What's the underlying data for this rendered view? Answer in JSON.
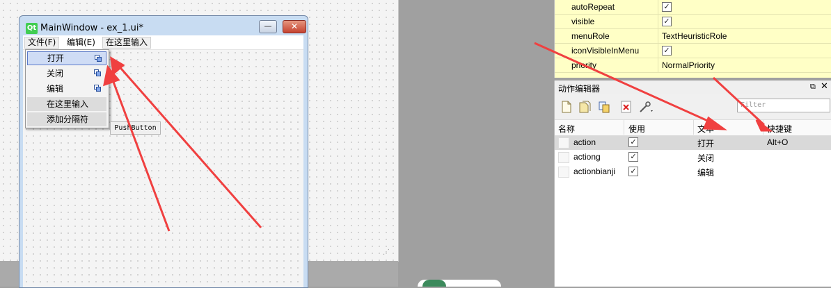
{
  "form": {
    "logo": "Qt",
    "title": "MainWindow - ex_1.ui*",
    "min_icon": "minimize-icon",
    "max_icon": "maximize-icon",
    "close_glyph": "✕"
  },
  "menubar": {
    "file": "文件(F)",
    "edit": "编辑(E)",
    "type_here": "在这里输入"
  },
  "dropdown": {
    "items": [
      {
        "label": "打开",
        "icon": "action-icon"
      },
      {
        "label": "关闭",
        "icon": "action-icon"
      },
      {
        "label": "编辑",
        "icon": "action-icon"
      },
      {
        "label": "在这里输入"
      },
      {
        "label": "添加分隔符"
      }
    ]
  },
  "pushbutton": "PushButton",
  "properties": [
    {
      "name": "autoRepeat",
      "checked": true
    },
    {
      "name": "visible",
      "checked": true
    },
    {
      "name": "menuRole",
      "value": "TextHeuristicRole"
    },
    {
      "name": "iconVisibleInMenu",
      "checked": true
    },
    {
      "name": "priority",
      "value": "NormalPriority"
    }
  ],
  "action_editor": {
    "title": "动作编辑器",
    "filter_placeholder": "Filter",
    "columns": [
      "名称",
      "使用",
      "文本",
      "快捷键"
    ],
    "rows": [
      {
        "name": "action",
        "used": true,
        "text": "打开",
        "shortcut": "Alt+O"
      },
      {
        "name": "actiong",
        "used": true,
        "text": "关闭",
        "shortcut": ""
      },
      {
        "name": "actionbianji",
        "used": true,
        "text": "编辑",
        "shortcut": ""
      }
    ],
    "toolbar_icons": [
      "new-action-icon",
      "open-icon",
      "copy-icon",
      "delete-icon",
      "configure-icon"
    ]
  },
  "colors": {
    "annotation_arrow": "#f04040",
    "property_bg": "#ffffc6",
    "selected_row": "#d9d9d9"
  }
}
